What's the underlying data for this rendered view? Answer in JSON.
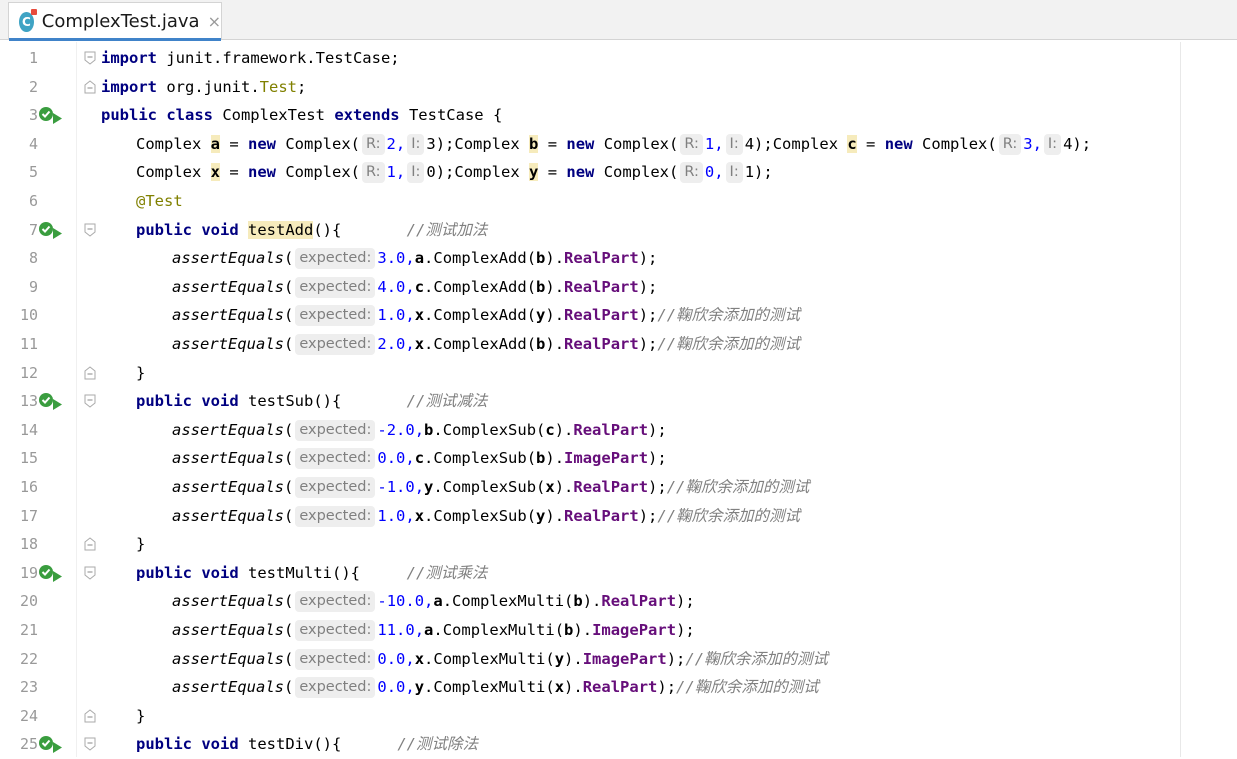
{
  "tab": {
    "title": "ComplexTest.java",
    "icon": "java-class-icon",
    "close": "×"
  },
  "colors": {
    "keyword": "#000080",
    "annotation": "#808000",
    "comment": "#808080",
    "field": "#660e7a",
    "run_icon": "#3a9d3f",
    "accent": "#4083c9"
  },
  "line_numbers": [
    "1",
    "2",
    "3",
    "4",
    "5",
    "6",
    "7",
    "8",
    "9",
    "10",
    "11",
    "12",
    "13",
    "14",
    "15",
    "16",
    "17",
    "18",
    "19",
    "20",
    "21",
    "22",
    "23",
    "24",
    "25"
  ],
  "code": {
    "l1": {
      "kw": "import",
      "rest": " junit.framework.TestCase;"
    },
    "l2": {
      "kw": "import",
      "pre": " org.junit.",
      "ann": "Test",
      "end": ";"
    },
    "l3": {
      "kw1": "public class",
      "name": " ComplexTest ",
      "kw2": "extends",
      "rest": " TestCase {"
    },
    "l4": {
      "t1": "Complex ",
      "v1": "a",
      "eq1": " = ",
      "new1": "new",
      "c1": " Complex(",
      "h1": "R:",
      "a1": "2,",
      "h2": "I:",
      "b1": "3);",
      "t2": "Complex ",
      "v2": "b",
      "eq2": " = ",
      "new2": "new",
      "c2": " Complex(",
      "h3": "R:",
      "a2": "1,",
      "h4": "I:",
      "b2": "4);",
      "t3": "Complex ",
      "v3": "c",
      "eq3": " = ",
      "new3": "new",
      "c3": " Complex(",
      "h5": "R:",
      "a3": "3,",
      "h6": "I:",
      "b3": "4);"
    },
    "l5": {
      "t1": "Complex ",
      "v1": "x",
      "eq1": " = ",
      "new1": "new",
      "c1": " Complex(",
      "h1": "R:",
      "a1": "1,",
      "h2": "I:",
      "b1": "0);",
      "t2": "Complex ",
      "v2": "y",
      "eq2": " = ",
      "new2": "new",
      "c2": " Complex(",
      "h3": "R:",
      "a2": "0,",
      "h4": "I:",
      "b2": "1);"
    },
    "l6": {
      "ann": "@Test"
    },
    "l7": {
      "kw": "public void",
      "name": "testAdd",
      "rest": "(){",
      "cmt": "//测试加法"
    },
    "l8": {
      "fn": "assertEquals",
      "open": "(",
      "hint": "expected:",
      "val": "3.0,",
      "obj": "a",
      "call": ".ComplexAdd(",
      "arg": "b",
      "close": ").",
      "fld": "RealPart",
      "end": ");",
      "cmt": ""
    },
    "l9": {
      "fn": "assertEquals",
      "open": "(",
      "hint": "expected:",
      "val": "4.0,",
      "obj": "c",
      "call": ".ComplexAdd(",
      "arg": "b",
      "close": ").",
      "fld": "RealPart",
      "end": ");",
      "cmt": ""
    },
    "l10": {
      "fn": "assertEquals",
      "open": "(",
      "hint": "expected:",
      "val": "1.0,",
      "obj": "x",
      "call": ".ComplexAdd(",
      "arg": "y",
      "close": ").",
      "fld": "RealPart",
      "end": ");",
      "cmt": "//鞠欣余添加的测试"
    },
    "l11": {
      "fn": "assertEquals",
      "open": "(",
      "hint": "expected:",
      "val": "2.0,",
      "obj": "x",
      "call": ".ComplexAdd(",
      "arg": "b",
      "close": ").",
      "fld": "RealPart",
      "end": ");",
      "cmt": "//鞠欣余添加的测试"
    },
    "l12": {
      "brace": "}"
    },
    "l13": {
      "kw": "public void",
      "name": "testSub",
      "rest": "(){",
      "cmt": "//测试减法"
    },
    "l14": {
      "fn": "assertEquals",
      "open": "(",
      "hint": "expected:",
      "val": "-2.0,",
      "obj": "b",
      "call": ".ComplexSub(",
      "arg": "c",
      "close": ").",
      "fld": "RealPart",
      "end": ");",
      "cmt": ""
    },
    "l15": {
      "fn": "assertEquals",
      "open": "(",
      "hint": "expected:",
      "val": "0.0,",
      "obj": "c",
      "call": ".ComplexSub(",
      "arg": "b",
      "close": ").",
      "fld": "ImagePart",
      "end": ");",
      "cmt": ""
    },
    "l16": {
      "fn": "assertEquals",
      "open": "(",
      "hint": "expected:",
      "val": "-1.0,",
      "obj": "y",
      "call": ".ComplexSub(",
      "arg": "x",
      "close": ").",
      "fld": "RealPart",
      "end": ");",
      "cmt": "//鞠欣余添加的测试"
    },
    "l17": {
      "fn": "assertEquals",
      "open": "(",
      "hint": "expected:",
      "val": "1.0,",
      "obj": "x",
      "call": ".ComplexSub(",
      "arg": "y",
      "close": ").",
      "fld": "RealPart",
      "end": ");",
      "cmt": "//鞠欣余添加的测试"
    },
    "l18": {
      "brace": "}"
    },
    "l19": {
      "kw": "public void",
      "name": "testMulti",
      "rest": "(){",
      "cmt": "//测试乘法"
    },
    "l20": {
      "fn": "assertEquals",
      "open": "(",
      "hint": "expected:",
      "val": "-10.0,",
      "obj": "a",
      "call": ".ComplexMulti(",
      "arg": "b",
      "close": ").",
      "fld": "RealPart",
      "end": ");",
      "cmt": ""
    },
    "l21": {
      "fn": "assertEquals",
      "open": "(",
      "hint": "expected:",
      "val": "11.0,",
      "obj": "a",
      "call": ".ComplexMulti(",
      "arg": "b",
      "close": ").",
      "fld": "ImagePart",
      "end": ");",
      "cmt": ""
    },
    "l22": {
      "fn": "assertEquals",
      "open": "(",
      "hint": "expected:",
      "val": "0.0,",
      "obj": "x",
      "call": ".ComplexMulti(",
      "arg": "y",
      "close": ").",
      "fld": "ImagePart",
      "end": ");",
      "cmt": "//鞠欣余添加的测试"
    },
    "l23": {
      "fn": "assertEquals",
      "open": "(",
      "hint": "expected:",
      "val": "0.0,",
      "obj": "y",
      "call": ".ComplexMulti(",
      "arg": "x",
      "close": ").",
      "fld": "RealPart",
      "end": ");",
      "cmt": "//鞠欣余添加的测试"
    },
    "l24": {
      "brace": "}"
    },
    "l25": {
      "kw": "public void",
      "name": "testDiv",
      "rest": "(){",
      "cmt": "//测试除法"
    }
  }
}
